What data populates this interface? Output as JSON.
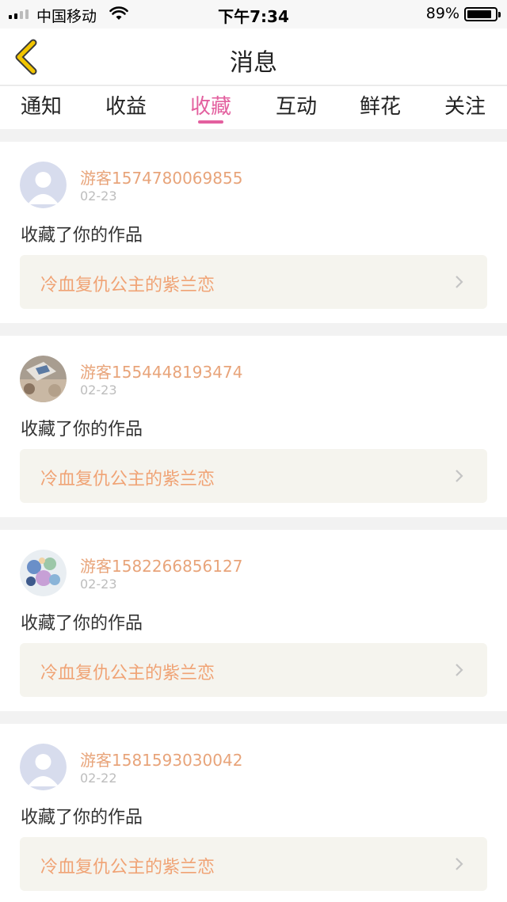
{
  "status_bar": {
    "carrier": "中国移动",
    "time": "下午7:34",
    "battery_percent": "89%",
    "battery_level": 0.89,
    "icons": [
      "signal-icon",
      "wifi-icon",
      "battery-icon"
    ]
  },
  "nav": {
    "title": "消息",
    "back_icon": "chevron-left-icon",
    "back_color": "#f2c500"
  },
  "tabs": {
    "items": [
      {
        "label": "通知"
      },
      {
        "label": "收益"
      },
      {
        "label": "收藏"
      },
      {
        "label": "互动"
      },
      {
        "label": "鲜花"
      },
      {
        "label": "关注"
      }
    ],
    "active_index": 2,
    "active_color": "#e3609f"
  },
  "messages": [
    {
      "username": "游客1574780069855",
      "date": "02-23",
      "action": "收藏了你的作品",
      "work_title": "冷血复仇公主的紫兰恋",
      "avatar": "default-avatar-icon"
    },
    {
      "username": "游客1554448193474",
      "date": "02-23",
      "action": "收藏了你的作品",
      "work_title": "冷血复仇公主的紫兰恋",
      "avatar": "photo-avatar"
    },
    {
      "username": "游客1582266856127",
      "date": "02-23",
      "action": "收藏了你的作品",
      "work_title": "冷血复仇公主的紫兰恋",
      "avatar": "anime-avatar"
    },
    {
      "username": "游客1581593030042",
      "date": "02-22",
      "action": "收藏了你的作品",
      "work_title": "冷血复仇公主的紫兰恋",
      "avatar": "default-avatar-icon"
    }
  ],
  "colors": {
    "username": "#e8a47a",
    "work_title": "#f0a375",
    "work_box_bg": "#f5f4ee"
  }
}
